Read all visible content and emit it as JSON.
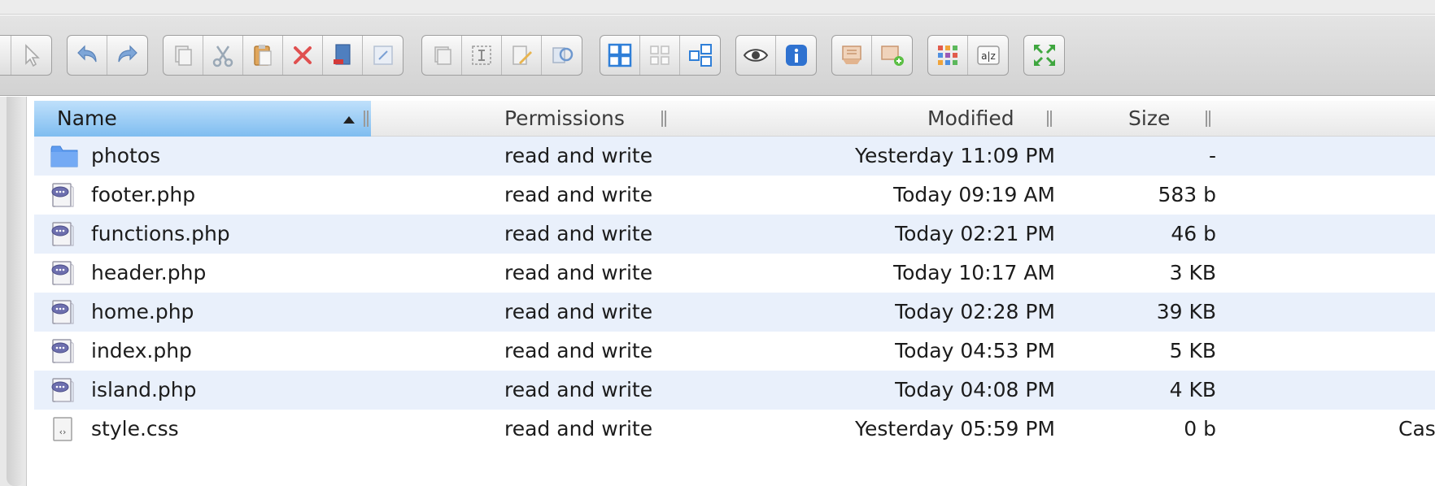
{
  "columns": {
    "name": "Name",
    "permissions": "Permissions",
    "modified": "Modified",
    "size": "Size"
  },
  "sort": {
    "column": "name",
    "direction": "ascending"
  },
  "toolbar_groups": [
    [
      "page-icon",
      "pointer-icon"
    ],
    [
      "undo-icon",
      "redo-icon"
    ],
    [
      "copy-icon",
      "cut-icon",
      "paste-icon",
      "delete-icon",
      "duplicate-icon",
      "resize-icon"
    ],
    [
      "stack-icon",
      "select-text-icon",
      "edit-icon",
      "sync-icon"
    ],
    [
      "large-grid-view-icon",
      "small-grid-view-icon",
      "mixed-view-icon"
    ],
    [
      "preview-eye-icon",
      "info-icon"
    ],
    [
      "upload-icon",
      "download-icon"
    ],
    [
      "color-grid-icon",
      "sort-az-icon"
    ],
    [
      "fullscreen-icon"
    ]
  ],
  "files": [
    {
      "icon": "folder-icon",
      "name": "photos",
      "permissions": "read and write",
      "modified": "Yesterday 11:09 PM",
      "size": "-",
      "kind": ""
    },
    {
      "icon": "php-file-icon",
      "name": "footer.php",
      "permissions": "read and write",
      "modified": "Today 09:19 AM",
      "size": "583 b",
      "kind": ""
    },
    {
      "icon": "php-file-icon",
      "name": "functions.php",
      "permissions": "read and write",
      "modified": "Today 02:21 PM",
      "size": "46 b",
      "kind": ""
    },
    {
      "icon": "php-file-icon",
      "name": "header.php",
      "permissions": "read and write",
      "modified": "Today 10:17 AM",
      "size": "3 KB",
      "kind": ""
    },
    {
      "icon": "php-file-icon",
      "name": "home.php",
      "permissions": "read and write",
      "modified": "Today 02:28 PM",
      "size": "39 KB",
      "kind": ""
    },
    {
      "icon": "php-file-icon",
      "name": "index.php",
      "permissions": "read and write",
      "modified": "Today 04:53 PM",
      "size": "5 KB",
      "kind": ""
    },
    {
      "icon": "php-file-icon",
      "name": "island.php",
      "permissions": "read and write",
      "modified": "Today 04:08 PM",
      "size": "4 KB",
      "kind": ""
    },
    {
      "icon": "css-file-icon",
      "name": "style.css",
      "permissions": "read and write",
      "modified": "Yesterday 05:59 PM",
      "size": "0 b",
      "kind": "Cas"
    }
  ],
  "colors": {
    "row_stripe": "#e9f0fb",
    "sorted_header": "#7fbdf0",
    "folder": "#5f9cf0"
  }
}
